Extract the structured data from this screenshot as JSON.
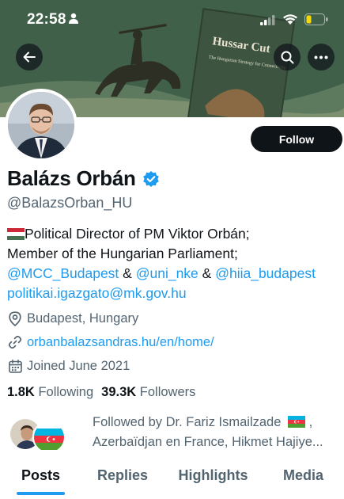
{
  "status_bar": {
    "time": "22:58"
  },
  "banner": {
    "book_title": "Hussar Cut",
    "book_subtitle": "The Hungarian Strategy for Connectivity"
  },
  "profile": {
    "name": "Balázs Orbán",
    "handle": "@BalazsOrban_HU",
    "follow_label": "Follow",
    "bio_line1": "Political Director of PM Viktor Orbán;",
    "bio_line2": "Member of the Hungarian Parliament;",
    "mention1": "@MCC_Budapest",
    "amp1": " & ",
    "mention2": "@uni_nke",
    "amp2": " & ",
    "mention3": "@hiia_budapest",
    "email": "politikai.igazgato@mk.gov.hu",
    "location": "Budapest, Hungary",
    "website": "orbanbalazsandras.hu/en/home/",
    "joined": "Joined June 2021",
    "following_count": "1.8K",
    "following_label": "Following",
    "followers_count": "39.3K",
    "followers_label": "Followers",
    "followed_by_line1": "Followed by Dr. Fariz Ismailzade",
    "followed_by_line1_end": " ,",
    "followed_by_line2": "Azerbaïdjan en France, Hikmet Hajiye..."
  },
  "tabs": [
    {
      "label": "Posts"
    },
    {
      "label": "Replies"
    },
    {
      "label": "Highlights"
    },
    {
      "label": "Media"
    }
  ],
  "colors": {
    "accent": "#1d9bf0",
    "text": "#0f1419",
    "secondary": "#536471",
    "verified": "#1d9bf0"
  }
}
